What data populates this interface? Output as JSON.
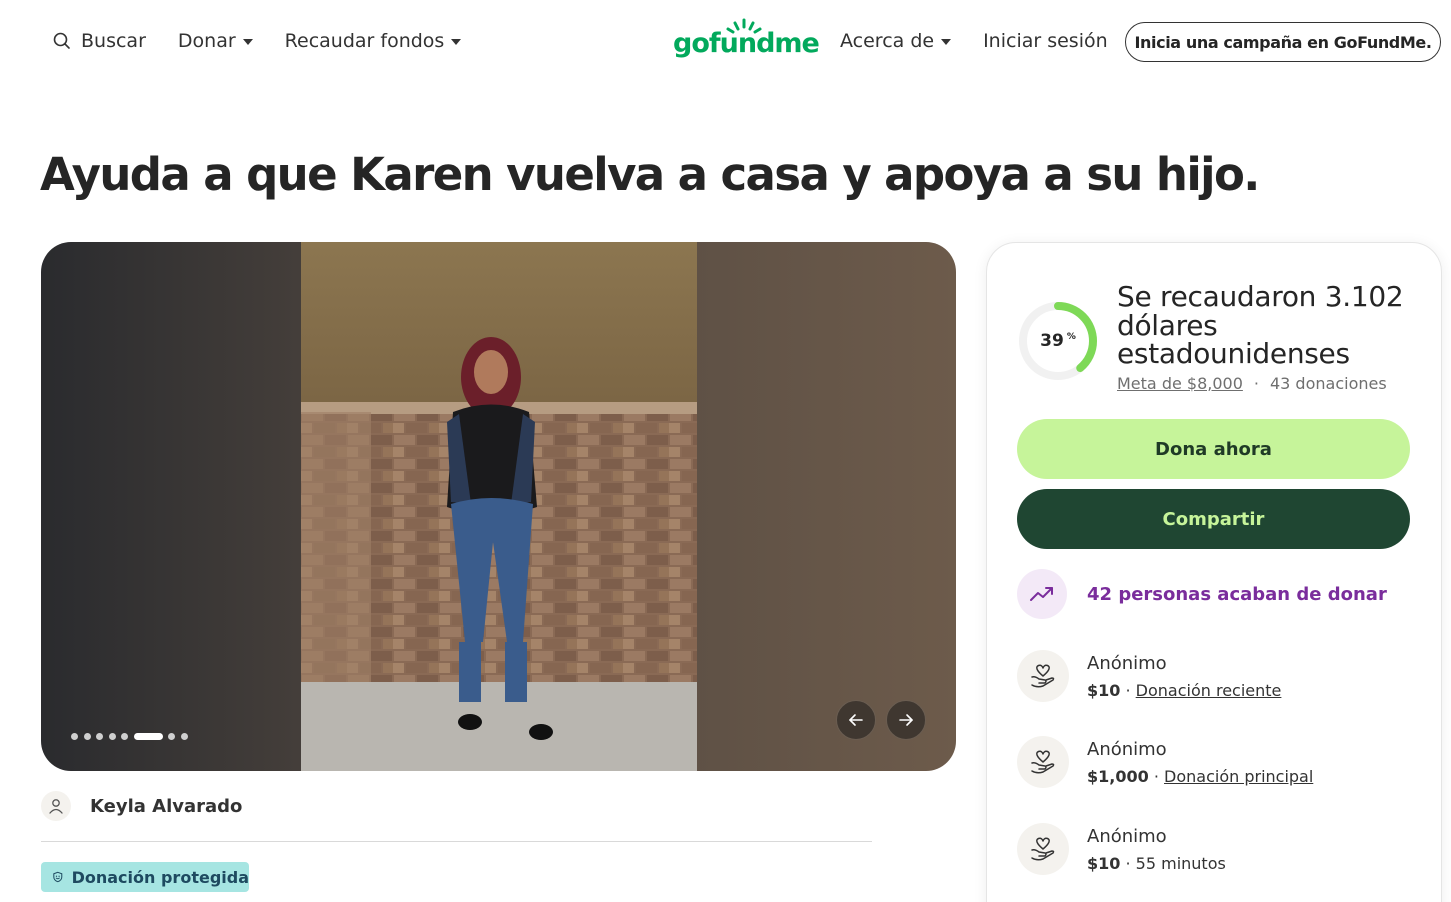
{
  "header": {
    "search_label": "Buscar",
    "donate_label": "Donar",
    "fundraise_label": "Recaudar fondos",
    "logo_text": "gofundme",
    "about_label": "Acerca de",
    "signin_label": "Iniciar sesión",
    "start_campaign_label": "Inicia una campaña en GoFundMe."
  },
  "campaign": {
    "title": "Ayuda a que Karen vuelva a casa y apoya a su hijo.",
    "organizer_name": "Keyla Alvarado",
    "protected_label": "Donación protegida"
  },
  "gallery": {
    "slide_count": 8,
    "active_slide": 5
  },
  "donation_card": {
    "progress_percent": 39,
    "progress_percent_label": "39",
    "percent_sign": "%",
    "raised_text": "Se recaudaron 3.102 dólares estadounidenses",
    "goal_text": "Meta de $8,000",
    "separator": "·",
    "donations_count_text": "43 donaciones",
    "donate_now_label": "Dona ahora",
    "share_label": "Compartir",
    "trend_text": "42 personas acaban de donar",
    "donors": [
      {
        "name": "Anónimo",
        "amount": "$10",
        "dot": " · ",
        "note": "Donación reciente",
        "note_is_link": true
      },
      {
        "name": "Anónimo",
        "amount": "$1,000",
        "dot": " · ",
        "note": "Donación principal",
        "note_is_link": true
      },
      {
        "name": "Anónimo",
        "amount": "$10",
        "dot": " · ",
        "note": "55 minutos",
        "note_is_link": false
      }
    ]
  },
  "colors": {
    "brand_green": "#02a95c",
    "donate_button": "#c6f49a",
    "share_button": "#1f4632",
    "progress": "#7ed957",
    "trend_purple": "#7a2d9c",
    "protected_badge": "#a6e5e2"
  },
  "icons": [
    "search-icon",
    "caret-down-icon",
    "user-icon",
    "shield-icon",
    "trend-up-icon",
    "heart-hand-icon",
    "arrow-left-icon",
    "arrow-right-icon"
  ]
}
